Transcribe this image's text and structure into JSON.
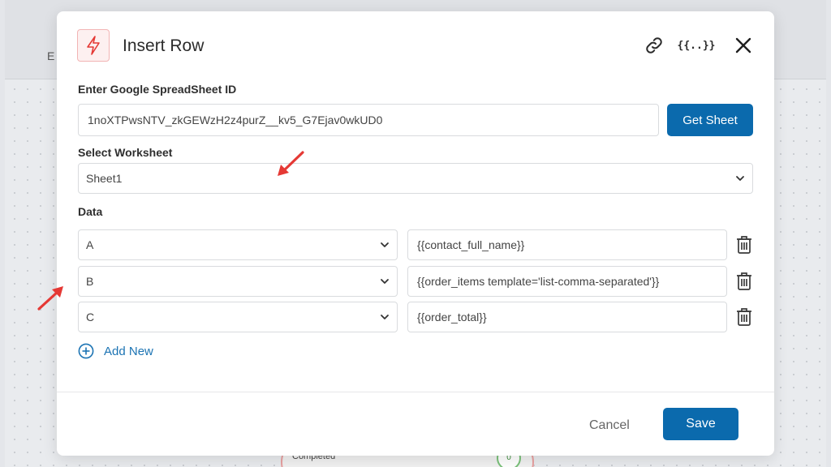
{
  "background": {
    "tab_text": "E",
    "node_label": "Completed",
    "node_badge": "0"
  },
  "modal": {
    "title": "Insert Row",
    "header_icons": {
      "app": "lightning-bolt-icon",
      "link": "link-icon",
      "variables_label": "{{..}}",
      "close": "close-icon"
    },
    "spreadsheet": {
      "label": "Enter Google SpreadSheet ID",
      "value": "1noXTPwsNTV_zkGEWzH2z4purZ__kv5_G7Ejav0wkUD0",
      "get_sheet_label": "Get Sheet"
    },
    "worksheet": {
      "label": "Select Worksheet",
      "selected": "Sheet1"
    },
    "data": {
      "label": "Data",
      "rows": [
        {
          "column": "A",
          "value": "{{contact_full_name}}"
        },
        {
          "column": "B",
          "value": "{{order_items template='list-comma-separated'}}"
        },
        {
          "column": "C",
          "value": "{{order_total}}"
        }
      ],
      "add_new_label": "Add New"
    },
    "footer": {
      "cancel_label": "Cancel",
      "save_label": "Save"
    }
  },
  "colors": {
    "primary": "#0b6aad",
    "accent_red": "#e53935",
    "link_blue": "#1b73b3"
  }
}
